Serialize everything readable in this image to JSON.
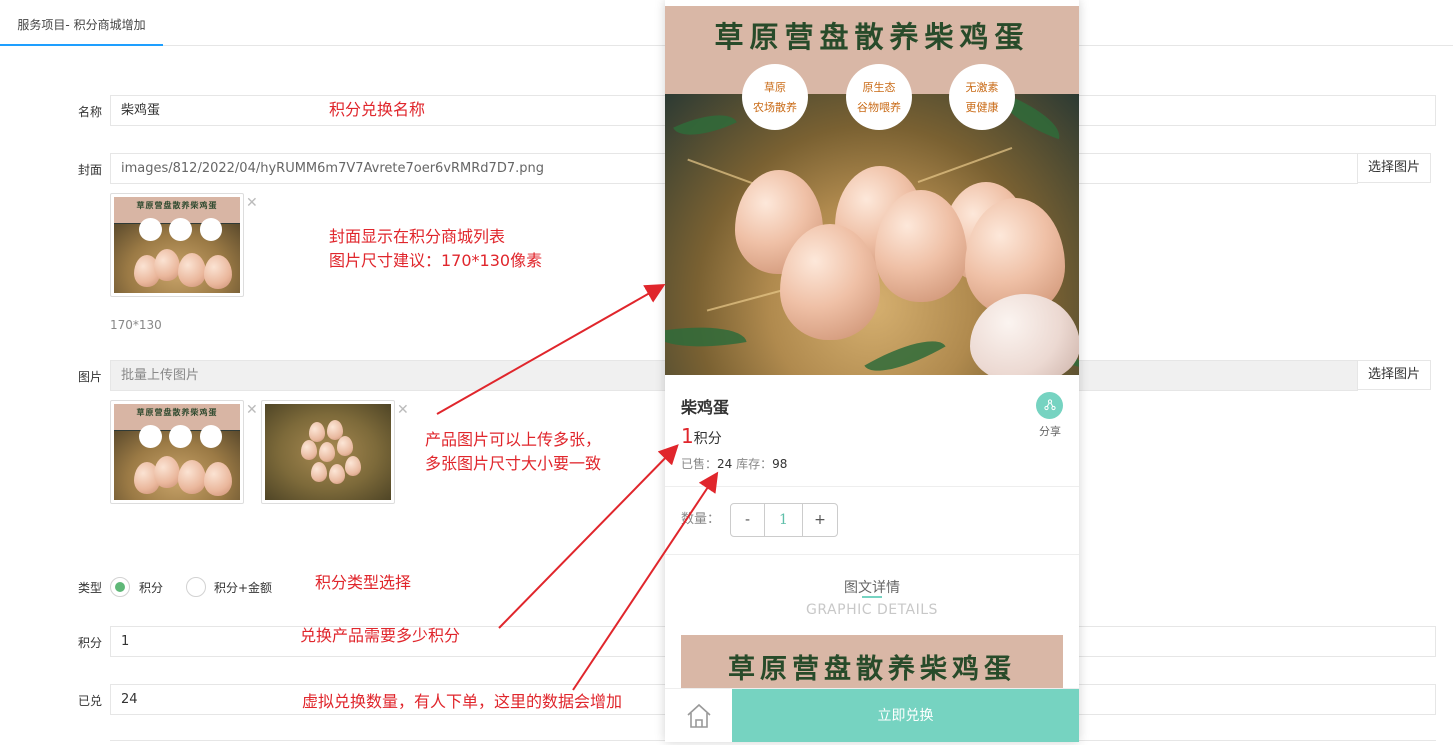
{
  "tab": {
    "label": "服务项目- 积分商城增加"
  },
  "form": {
    "name": {
      "label": "名称",
      "value": "柴鸡蛋"
    },
    "cover": {
      "label": "封面",
      "value": "images/812/2022/04/hyRUMM6m7V7Avrete7oer6vRMRd7D7.png",
      "button": "选择图片",
      "size_hint": "170*130"
    },
    "images": {
      "label": "图片",
      "placeholder": "批量上传图片",
      "button": "选择图片"
    },
    "type": {
      "label": "类型",
      "options": [
        "积分",
        "积分+金额"
      ],
      "selected": "积分"
    },
    "points": {
      "label": "积分",
      "value": "1"
    },
    "sold": {
      "label": "已兑",
      "value": "24"
    },
    "close_symbol": "✕"
  },
  "poster": {
    "title": "草原营盘散养柴鸡蛋",
    "badges": [
      {
        "line1": "草原",
        "line2": "农场散养"
      },
      {
        "line1": "原生态",
        "line2": "谷物喂养"
      },
      {
        "line1": "无激素",
        "line2": "更健康"
      }
    ]
  },
  "annotations": {
    "name_note": "积分兑换名称",
    "cover_note_line1": "封面显示在积分商城列表",
    "cover_note_line2": "图片尺寸建议：170*130像素",
    "images_note_line1": "产品图片可以上传多张，",
    "images_note_line2": "多张图片尺寸大小要一致",
    "type_note": "积分类型选择",
    "points_note": "兑换产品需要多少积分",
    "sold_note": "虚拟兑换数量，有人下单，这里的数据会增加"
  },
  "preview": {
    "product_name": "柴鸡蛋",
    "share_label": "分享",
    "points_value": "1",
    "points_unit": "积分",
    "sold_label": "已售：",
    "sold_value": "24",
    "stock_label": "库存：",
    "stock_value": "98",
    "qty_label": "数量：",
    "qty_minus": "-",
    "qty_value": "1",
    "qty_plus": "+",
    "detail_title": "图文详情",
    "detail_subtitle": "GRAPHIC DETAILS",
    "buy_button": "立即兑换",
    "icons": {
      "share": "share-icon",
      "home": "home-icon"
    }
  },
  "colors": {
    "accent": "#76d3c1",
    "annotation": "#e0262c",
    "radio_on": "#5fb878",
    "tab_underline": "#1e9fff",
    "poster_band": "#d9b7a6"
  }
}
